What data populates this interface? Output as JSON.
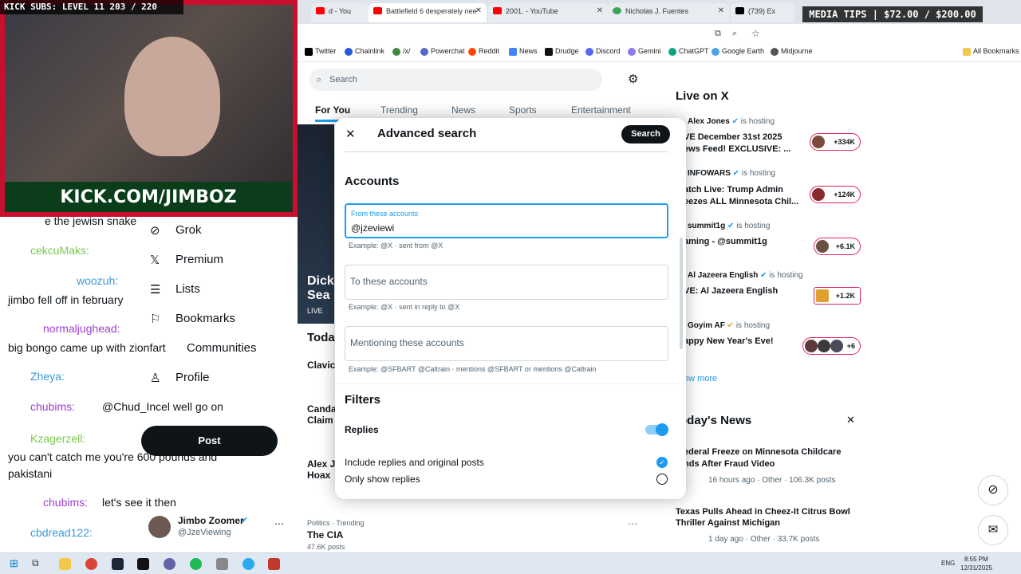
{
  "stream": {
    "kick_banner": "KICK SUBS: LEVEL 11 203 / 220",
    "media_tips": "MEDIA TIPS | $72.00 / $200.00",
    "cam_banner": "KICK.COM/JIMBOZ"
  },
  "browser": {
    "tabs": [
      {
        "label": "d - You"
      },
      {
        "label": "Battlefield 6 desperately nee"
      },
      {
        "label": "2001. - YouTube"
      },
      {
        "label": "Nicholas J. Fuentes"
      },
      {
        "label": "(739) Ex"
      }
    ],
    "bookmarks": [
      "Twitter",
      "Chainlink",
      "/x/",
      "Powerchat",
      "Reddit",
      "News",
      "Drudge",
      "Discord",
      "Gemini",
      "ChatGPT",
      "Google Earth",
      "Midjourne",
      "All Bookmarks"
    ]
  },
  "x": {
    "search_placeholder": "Search",
    "tabs": [
      "For You",
      "Trending",
      "News",
      "Sports",
      "Entertainment"
    ],
    "sidebar": [
      "Grok",
      "Premium",
      "Lists",
      "Bookmarks",
      "Communities",
      "Profile"
    ],
    "post_button": "Post",
    "account": {
      "name": "Jimbo Zoomer",
      "handle": "@JzeViewing"
    },
    "feed": {
      "card_title_1": "Dick",
      "card_title_2": "Sea",
      "card_live": "LIVE",
      "today": "Toda",
      "items": [
        "Clavic",
        "Canda",
        "Claim",
        "Alex J",
        "Hoax"
      ],
      "trend_meta": "Politics · Trending",
      "trend_name": "The CIA",
      "trend_posts": "47.6K posts"
    },
    "live": {
      "title": "Live on X",
      "is_hosting": "is hosting",
      "items": [
        {
          "host": "Alex Jones",
          "title1": "VE December 31st 2025",
          "title2": "ews Feed! EXCLUSIVE: ...",
          "count": "+334K"
        },
        {
          "host": "INFOWARS",
          "title1": "atch Live: Trump Admin",
          "title2": "eezes ALL Minnesota Chil...",
          "count": "+124K"
        },
        {
          "host": "summit1g",
          "title1": "aming - @summit1g",
          "title2": "",
          "count": "+6.1K"
        },
        {
          "host": "Al Jazeera English",
          "title1": "VE: Al Jazeera English",
          "title2": "",
          "count": "+1.2K"
        },
        {
          "host": "Goyim AF",
          "title1": "appy New Year's Eve!",
          "title2": "",
          "count": "+6"
        }
      ],
      "show_more": "ow more"
    },
    "news": {
      "title": "oday's News",
      "items": [
        {
          "t1": "ederal Freeze on Minnesota Childcare",
          "t2": "nds After Fraud Video",
          "meta": "16 hours ago · Other · 106.3K posts"
        },
        {
          "t1": "Texas Pulls Ahead in Cheez-It Citrus Bowl",
          "t2": "Thriller Against Michigan",
          "meta": "1 day ago · Other · 33.7K posts"
        }
      ]
    }
  },
  "modal": {
    "title": "Advanced search",
    "search_button": "Search",
    "accounts_heading": "Accounts",
    "from_label": "From these accounts",
    "from_value": "@jzeviewi",
    "from_hint": "Example: @X · sent from @X",
    "to_placeholder": "To these accounts",
    "to_hint": "Example: @X · sent in reply to @X",
    "mention_placeholder": "Mentioning these accounts",
    "mention_hint": "Example: @SFBART @Caltrain · mentions @SFBART or mentions @Caltrain",
    "filters_heading": "Filters",
    "replies_label": "Replies",
    "opt1": "Include replies and original posts",
    "opt2": "Only show replies"
  },
  "chat": [
    {
      "user": "",
      "msg": "e the jewisn snake"
    },
    {
      "user": "cekcuMaks:",
      "msg": ""
    },
    {
      "user": "woozuh:",
      "msg": "jimbo fell off in february"
    },
    {
      "user": "normaljughead:",
      "msg": "big bongo came up with zionfart"
    },
    {
      "user": "Zheya:",
      "msg": ""
    },
    {
      "user": "chubims:",
      "msg": "@Chud_Incel well go on"
    },
    {
      "user": "Kzagerzell:",
      "msg": "you can't catch me you're 600 pounds and"
    },
    {
      "user": "",
      "msg": "pakistani"
    },
    {
      "user": "chubims:",
      "msg": "let's see it then"
    },
    {
      "user": "cbdread122:",
      "msg": ""
    }
  ],
  "taskbar": {
    "lang": "ENG",
    "time": "8:55 PM",
    "date": "12/31/2025"
  }
}
